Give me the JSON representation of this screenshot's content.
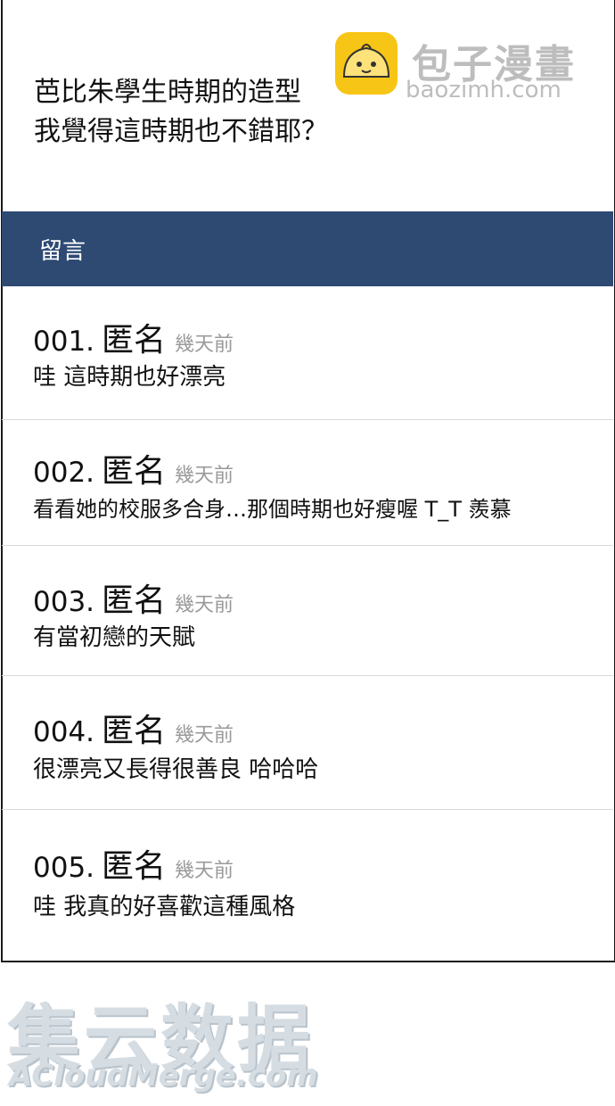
{
  "post": {
    "line1": "芭比朱學生時期的造型",
    "line2": "我覺得這時期也不錯耶？"
  },
  "watermark_top": {
    "text": "包子漫畫",
    "url": "baozimh.com",
    "logo_icon": "bun-mascot-icon",
    "logo_color": "#f7c515"
  },
  "comments_header": {
    "title": "留言",
    "bg_color": "#2e4a73"
  },
  "comments": [
    {
      "number": "001.",
      "name": "匿名",
      "time": "幾天前",
      "text": "哇 這時期也好漂亮"
    },
    {
      "number": "002.",
      "name": "匿名",
      "time": "幾天前",
      "text": "看看她的校服多合身…那個時期也好瘦喔 T_T 羨慕"
    },
    {
      "number": "003.",
      "name": "匿名",
      "time": "幾天前",
      "text": "有當初戀的天賦"
    },
    {
      "number": "004.",
      "name": "匿名",
      "time": "幾天前",
      "text": "很漂亮又長得很善良 哈哈哈"
    },
    {
      "number": "005.",
      "name": "匿名",
      "time": "幾天前",
      "text": "哇 我真的好喜歡這種風格"
    }
  ],
  "watermark_bottom": {
    "text": "集云数据",
    "url": "ACloudMerge.com"
  }
}
